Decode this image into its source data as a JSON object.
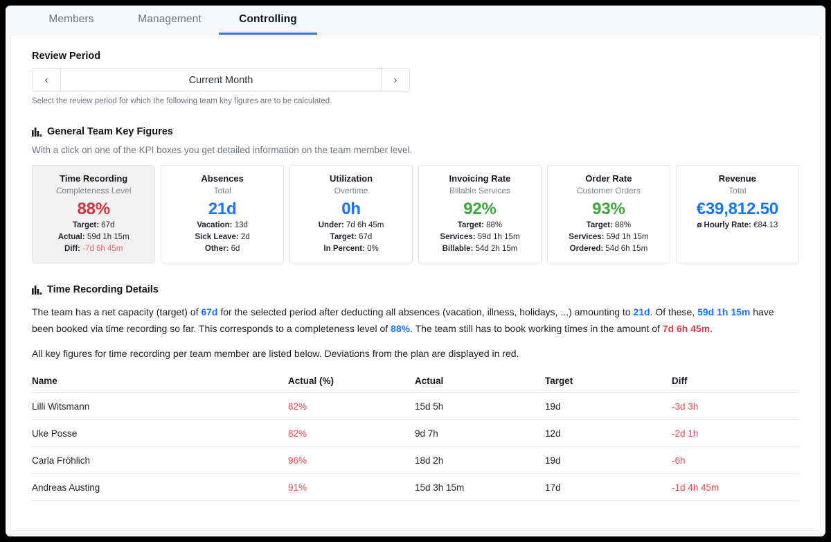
{
  "tabs": [
    {
      "label": "Members",
      "active": false
    },
    {
      "label": "Management",
      "active": false
    },
    {
      "label": "Controlling",
      "active": true
    }
  ],
  "review_period": {
    "heading": "Review Period",
    "prev_label": "‹",
    "value": "Current Month",
    "next_label": "›",
    "hint": "Select the review period for which the following team key figures are to be calculated."
  },
  "general_key_figures": {
    "heading": "General Team Key Figures",
    "subtitle": "With a click on one of the KPI boxes you get detailed information on the team member level.",
    "cards": [
      {
        "title": "Time Recording",
        "subtitle": "Completeness Level",
        "value": "88%",
        "value_color": "red",
        "selected": true,
        "rows": [
          {
            "label": "Target:",
            "value": "67d",
            "value_color": ""
          },
          {
            "label": "Actual:",
            "value": "59d 1h 15m",
            "value_color": ""
          },
          {
            "label": "Diff:",
            "value": "-7d 6h 45m",
            "value_color": "red"
          }
        ]
      },
      {
        "title": "Absences",
        "subtitle": "Total",
        "value": "21d",
        "value_color": "blue",
        "selected": false,
        "rows": [
          {
            "label": "Vacation:",
            "value": "13d",
            "value_color": ""
          },
          {
            "label": "Sick Leave:",
            "value": "2d",
            "value_color": ""
          },
          {
            "label": "Other:",
            "value": "6d",
            "value_color": ""
          }
        ]
      },
      {
        "title": "Utilization",
        "subtitle": "Overtime",
        "value": "0h",
        "value_color": "blue",
        "selected": false,
        "rows": [
          {
            "label": "Under:",
            "value": "7d 6h 45m",
            "value_color": ""
          },
          {
            "label": "Target:",
            "value": "67d",
            "value_color": ""
          },
          {
            "label": "In Percent:",
            "value": "0%",
            "value_color": ""
          }
        ]
      },
      {
        "title": "Invoicing Rate",
        "subtitle": "Billable Services",
        "value": "92%",
        "value_color": "green",
        "selected": false,
        "rows": [
          {
            "label": "Target:",
            "value": "88%",
            "value_color": ""
          },
          {
            "label": "Services:",
            "value": "59d 1h 15m",
            "value_color": ""
          },
          {
            "label": "Billable:",
            "value": "54d 2h 15m",
            "value_color": ""
          }
        ]
      },
      {
        "title": "Order Rate",
        "subtitle": "Customer Orders",
        "value": "93%",
        "value_color": "green",
        "selected": false,
        "rows": [
          {
            "label": "Target:",
            "value": "88%",
            "value_color": ""
          },
          {
            "label": "Services:",
            "value": "59d 1h 15m",
            "value_color": ""
          },
          {
            "label": "Ordered:",
            "value": "54d 6h 15m",
            "value_color": ""
          }
        ]
      },
      {
        "title": "Revenue",
        "subtitle": "Total",
        "value": "€39,812.50",
        "value_color": "blue",
        "selected": false,
        "rows": [
          {
            "label": "ø Hourly Rate:",
            "value": "€84.13",
            "value_color": ""
          }
        ]
      }
    ]
  },
  "time_recording_details": {
    "heading": "Time Recording Details",
    "paragraph1": {
      "p1": "The team has a net capacity (target) of ",
      "v1": "67d",
      "p2": " for the selected period after deducting all absences (vacation, illness, holidays, ...) amounting to ",
      "v2": "21d",
      "p3": ". Of these, ",
      "v3": "59d 1h 15m",
      "p4": " have been booked via time recording so far. This corresponds to a completeness level of ",
      "v4": "88%",
      "p5": ". The team still has to book working times in the amount of ",
      "v5": "7d 6h 45m",
      "p6": "."
    },
    "paragraph2": "All key figures for time recording per team member are listed below. Deviations from the plan are displayed in red.",
    "table": {
      "columns": [
        "Name",
        "Actual (%)",
        "Actual",
        "Target",
        "Diff"
      ],
      "rows": [
        {
          "name": "Lilli Witsmann",
          "actual_pct": "82%",
          "actual": "15d 5h",
          "target": "19d",
          "diff": "-3d 3h"
        },
        {
          "name": "Uke Posse",
          "actual_pct": "82%",
          "actual": "9d 7h",
          "target": "12d",
          "diff": "-2d 1h"
        },
        {
          "name": "Carla Fröhlich",
          "actual_pct": "96%",
          "actual": "18d 2h",
          "target": "19d",
          "diff": "-6h"
        },
        {
          "name": "Andreas Austing",
          "actual_pct": "91%",
          "actual": "15d 3h 15m",
          "target": "17d",
          "diff": "-1d 4h 45m"
        }
      ]
    }
  },
  "colors": {
    "accent_blue": "#1a73ff",
    "tab_underline": "#3274f6",
    "danger_red": "#d8323f",
    "success_green": "#3fa53c"
  }
}
